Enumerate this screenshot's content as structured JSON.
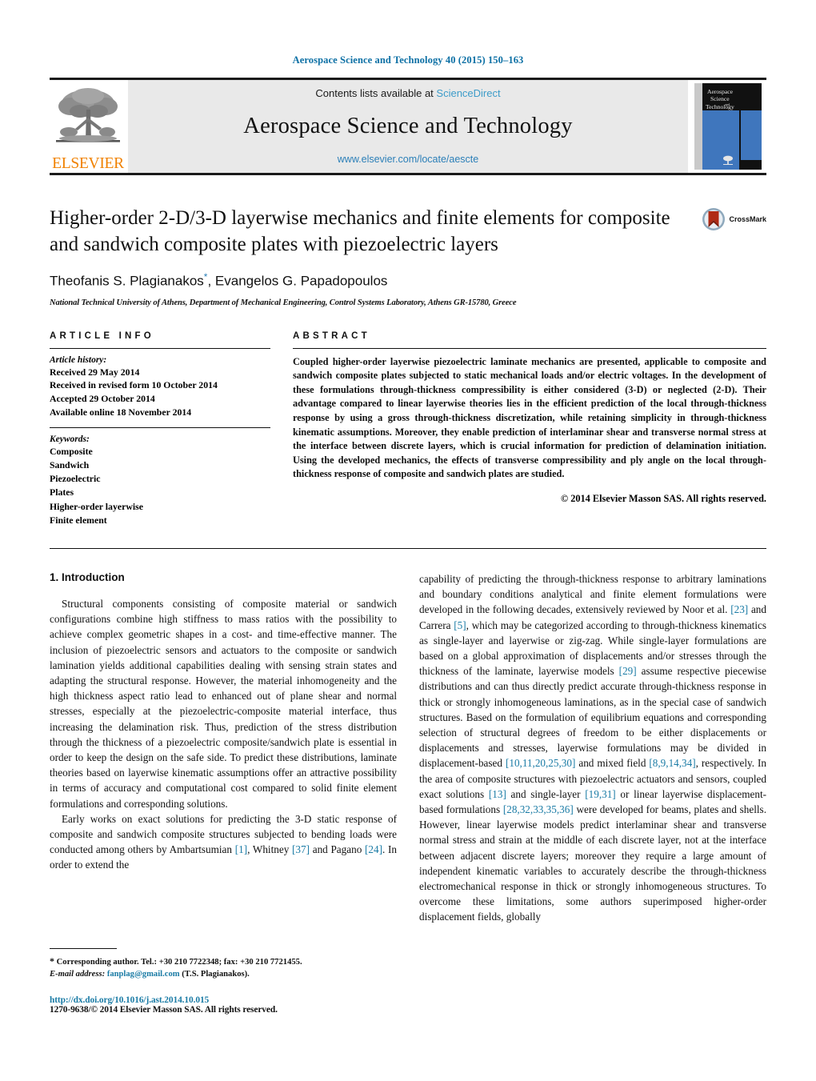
{
  "journal_ref": "Aerospace Science and Technology 40 (2015) 150–163",
  "masthead": {
    "contents_prefix": "Contents lists available at ",
    "sciencedirect": "ScienceDirect",
    "journal_name": "Aerospace Science and Technology",
    "journal_url": "www.elsevier.com/locate/aescte",
    "publisher_word": "ELSEVIER",
    "cover_title_lines": [
      "Aerospace",
      "Science",
      "and",
      "Technology"
    ],
    "link_color": "#3d9cc9",
    "accent_orange": "#f08100"
  },
  "article": {
    "title": "Higher-order 2-D/3-D layerwise mechanics and finite elements for composite and sandwich composite plates with piezoelectric layers",
    "authors": "Theofanis S. Plagianakos",
    "corresponding_marker": "*",
    "authors_rest": ", Evangelos G. Papadopoulos",
    "affiliation": "National Technical University of Athens, Department of Mechanical Engineering, Control Systems Laboratory, Athens GR-15780, Greece",
    "crossmark_label": "CrossMark"
  },
  "info": {
    "heading": "ARTICLE INFO",
    "history_label": "Article history:",
    "history": [
      "Received 29 May 2014",
      "Received in revised form 10 October 2014",
      "Accepted 29 October 2014",
      "Available online 18 November 2014"
    ],
    "keywords_label": "Keywords:",
    "keywords": [
      "Composite",
      "Sandwich",
      "Piezoelectric",
      "Plates",
      "Higher-order layerwise",
      "Finite element"
    ]
  },
  "abstract": {
    "heading": "ABSTRACT",
    "text": "Coupled higher-order layerwise piezoelectric laminate mechanics are presented, applicable to composite and sandwich composite plates subjected to static mechanical loads and/or electric voltages. In the development of these formulations through-thickness compressibility is either considered (3-D) or neglected (2-D). Their advantage compared to linear layerwise theories lies in the efficient prediction of the local through-thickness response by using a gross through-thickness discretization, while retaining simplicity in through-thickness kinematic assumptions. Moreover, they enable prediction of interlaminar shear and transverse normal stress at the interface between discrete layers, which is crucial information for prediction of delamination initiation. Using the developed mechanics, the effects of transverse compressibility and ply angle on the local through-thickness response of composite and sandwich plates are studied.",
    "copyright": "© 2014 Elsevier Masson SAS. All rights reserved."
  },
  "body": {
    "section_number_title": "1. Introduction",
    "left_paragraphs": [
      "Structural components consisting of composite material or sandwich configurations combine high stiffness to mass ratios with the possibility to achieve complex geometric shapes in a cost- and time-effective manner. The inclusion of piezoelectric sensors and actuators to the composite or sandwich lamination yields additional capabilities dealing with sensing strain states and adapting the structural response. However, the material inhomogeneity and the high thickness aspect ratio lead to enhanced out of plane shear and normal stresses, especially at the piezoelectric-composite material interface, thus increasing the delamination risk. Thus, prediction of the stress distribution through the thickness of a piezoelectric composite/sandwich plate is essential in order to keep the design on the safe side. To predict these distributions, laminate theories based on layerwise kinematic assumptions offer an attractive possibility in terms of accuracy and computational cost compared to solid finite element formulations and corresponding solutions."
    ],
    "left_para2_segments": [
      {
        "t": "Early works on exact solutions for predicting the 3-D static response of composite and sandwich composite structures subjected to bending loads were conducted among others by Ambartsumian ",
        "cite": false
      },
      {
        "t": "[1]",
        "cite": true
      },
      {
        "t": ", Whitney ",
        "cite": false
      },
      {
        "t": "[37]",
        "cite": true
      },
      {
        "t": " and Pagano ",
        "cite": false
      },
      {
        "t": "[24]",
        "cite": true
      },
      {
        "t": ". In order to extend the",
        "cite": false
      }
    ],
    "right_para_segments": [
      {
        "t": "capability of predicting the through-thickness response to arbitrary laminations and boundary conditions analytical and finite element formulations were developed in the following decades, extensively reviewed by Noor et al. ",
        "cite": false
      },
      {
        "t": "[23]",
        "cite": true
      },
      {
        "t": " and Carrera ",
        "cite": false
      },
      {
        "t": "[5]",
        "cite": true
      },
      {
        "t": ", which may be categorized according to through-thickness kinematics as single-layer and layerwise or zig-zag. While single-layer formulations are based on a global approximation of displacements and/or stresses through the thickness of the laminate, layerwise models ",
        "cite": false
      },
      {
        "t": "[29]",
        "cite": true
      },
      {
        "t": " assume respective piecewise distributions and can thus directly predict accurate through-thickness response in thick or strongly inhomogeneous laminations, as in the special case of sandwich structures. Based on the formulation of equilibrium equations and corresponding selection of structural degrees of freedom to be either displacements or displacements and stresses, layerwise formulations may be divided in displacement-based ",
        "cite": false
      },
      {
        "t": "[10,11,20,25,30]",
        "cite": true
      },
      {
        "t": " and mixed field ",
        "cite": false
      },
      {
        "t": "[8,9,14,34]",
        "cite": true
      },
      {
        "t": ", respectively. In the area of composite structures with piezoelectric actuators and sensors, coupled exact solutions ",
        "cite": false
      },
      {
        "t": "[13]",
        "cite": true
      },
      {
        "t": " and single-layer ",
        "cite": false
      },
      {
        "t": "[19,31]",
        "cite": true
      },
      {
        "t": " or linear layerwise displacement-based formulations ",
        "cite": false
      },
      {
        "t": "[28,32,33,35,36]",
        "cite": true
      },
      {
        "t": " were developed for beams, plates and shells. However, linear layerwise models predict interlaminar shear and transverse normal stress and strain at the middle of each discrete layer, not at the interface between adjacent discrete layers; moreover they require a large amount of independent kinematic variables to accurately describe the through-thickness electromechanical response in thick or strongly inhomogeneous structures. To overcome these limitations, some authors superimposed higher-order displacement fields, globally",
        "cite": false
      }
    ]
  },
  "footnote": {
    "star": "*",
    "corresponding": "Corresponding author. Tel.: +30 210 7722348; fax: +30 210 7721455.",
    "email_label": "E-mail address:",
    "email": "fanplag@gmail.com",
    "email_owner": "(T.S. Plagianakos).",
    "doi": "http://dx.doi.org/10.1016/j.ast.2014.10.015",
    "issn": "1270-9638/© 2014 Elsevier Masson SAS. All rights reserved.",
    "link_color": "#1a7ba5"
  }
}
